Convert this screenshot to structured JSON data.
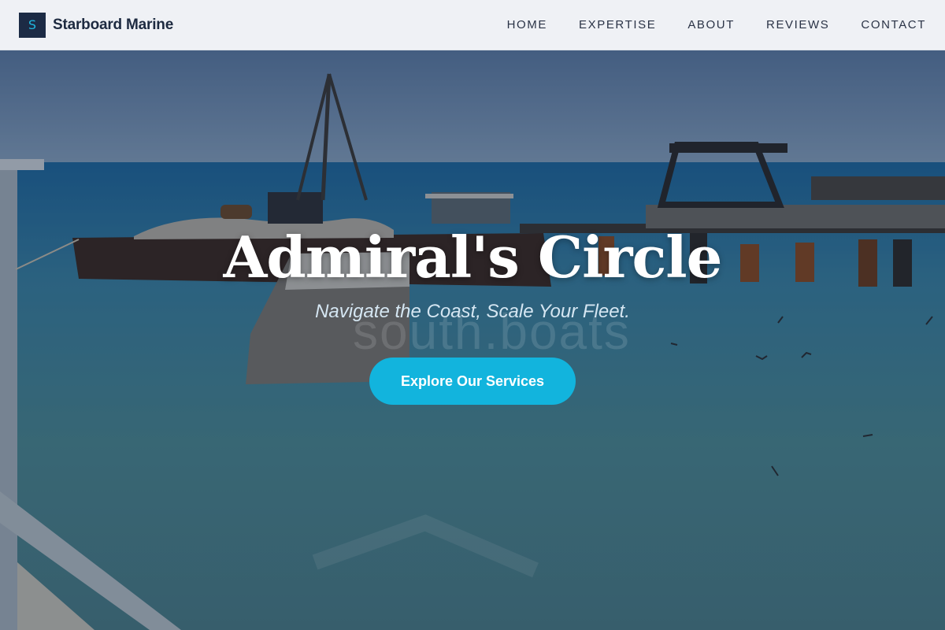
{
  "header": {
    "logo_letter": "S",
    "brand_name": "Starboard Marine",
    "nav": [
      {
        "label": "HOME"
      },
      {
        "label": "EXPERTISE"
      },
      {
        "label": "ABOUT"
      },
      {
        "label": "REVIEWS"
      },
      {
        "label": "CONTACT"
      }
    ]
  },
  "hero": {
    "title": "Admiral's Circle",
    "subtitle": "Navigate the Coast, Scale Your Fleet.",
    "cta_label": "Explore Our Services",
    "watermark": "south.boats"
  },
  "colors": {
    "header_bg": "#eff1f5",
    "logo_bg": "#1c2b45",
    "logo_letter": "#1fb6dd",
    "cta_bg": "#12b4dd",
    "text_dark": "#1d2a40"
  }
}
